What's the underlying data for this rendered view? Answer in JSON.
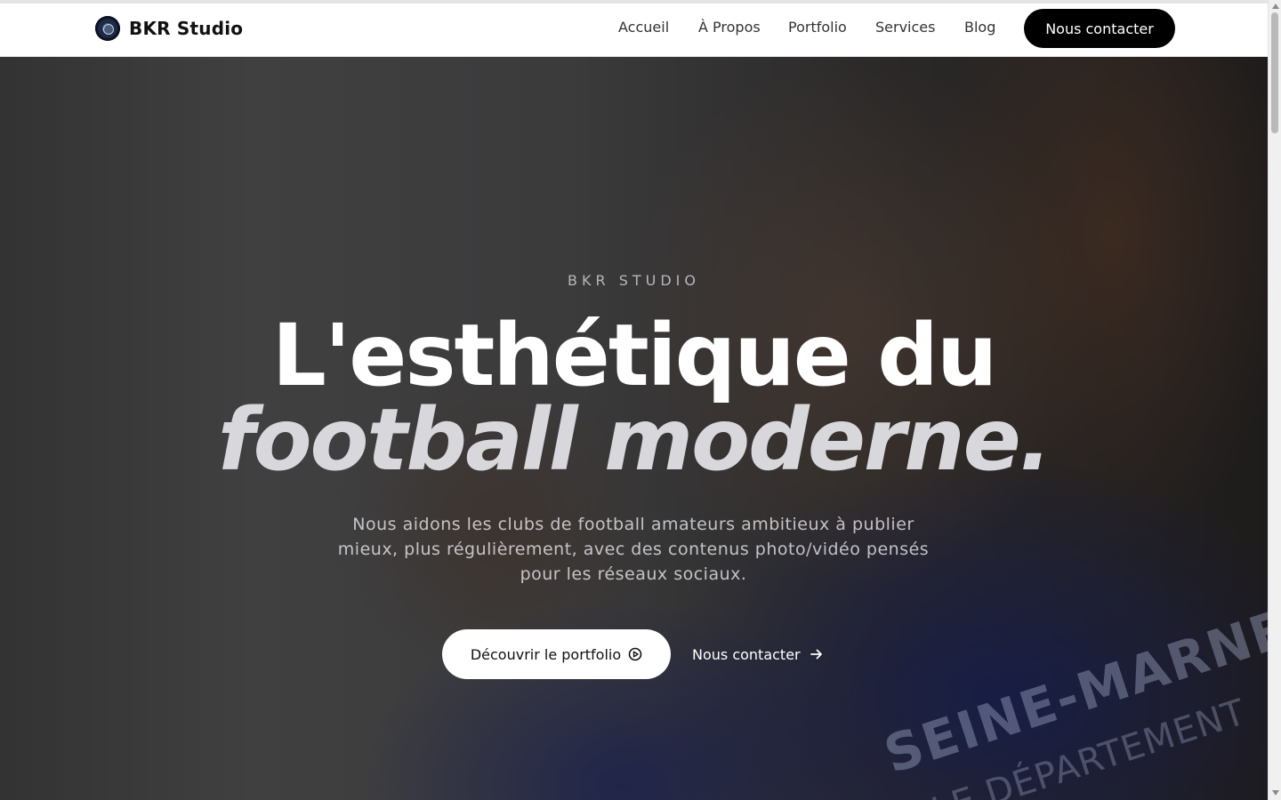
{
  "brand": {
    "name": "BKR Studio",
    "logo_icon": "bkr-logo-icon"
  },
  "nav": {
    "items": [
      {
        "label": "Accueil"
      },
      {
        "label": "À Propos"
      },
      {
        "label": "Portfolio"
      },
      {
        "label": "Services"
      },
      {
        "label": "Blog"
      }
    ],
    "cta_label": "Nous contacter"
  },
  "hero": {
    "eyebrow": "BKR STUDIO",
    "headline_line1": "L'esthétique du",
    "headline_line2": "football moderne.",
    "subtitle": "Nous aidons les clubs de football amateurs ambitieux à publier mieux, plus régulièrement, avec des contenus photo/vidéo pensés pour les réseaux sociaux.",
    "primary_button": {
      "label": "Découvrir le portfolio",
      "icon": "play-circle-icon"
    },
    "secondary_button": {
      "label": "Nous contacter",
      "icon": "arrow-right-icon"
    },
    "jersey_text_1": "SEINE-MARNE",
    "jersey_text_2": "LE DÉPARTEMENT"
  },
  "colors": {
    "nav_bg": "#ffffff",
    "cta_bg": "#000000",
    "text_dark": "#111111",
    "hero_overlay": "#0a0a0c"
  }
}
